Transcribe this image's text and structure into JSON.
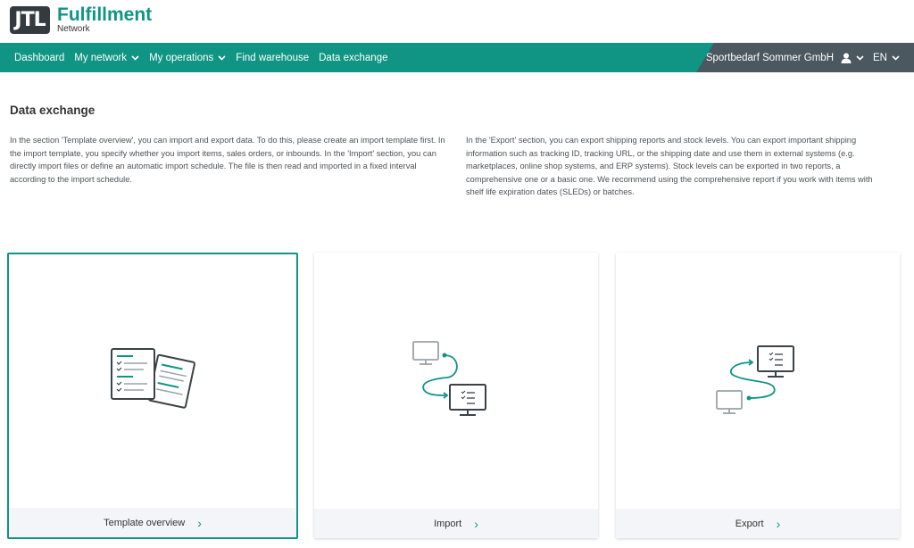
{
  "brand": {
    "logo_abbr": "JTL",
    "title": "Fulfillment",
    "subtitle": "Network",
    "accent": "#109584",
    "dark": "#4b5860"
  },
  "nav": {
    "items": [
      {
        "label": "Dashboard"
      },
      {
        "label": "My network"
      },
      {
        "label": "My operations"
      },
      {
        "label": "Find warehouse"
      },
      {
        "label": "Data exchange"
      }
    ],
    "company": "Sportbedarf Sommer GmbH",
    "language": "EN"
  },
  "page": {
    "title": "Data exchange",
    "desc_left": "In the section 'Template overview', you can import and export data. To do this, please create an import template first. In the import template, you specify whether you import items, sales orders, or inbounds. In the 'Import' section, you can directly import files or define an automatic import schedule. The file is then read and imported in a fixed interval according to the import schedule.",
    "desc_right": "In the 'Export' section, you can export shipping reports and stock levels. You can export important shipping information such as tracking ID, tracking URL, or the shipping date and use them in external systems (e.g. marketplaces, online shop systems, and ERP systems). Stock levels can be exported in two reports, a comprehensive one or a basic one. We recommend using the comprehensive report if you work with items with shelf life expiration dates (SLEDs) or batches."
  },
  "cards": [
    {
      "label": "Template overview",
      "icon": "documents-icon"
    },
    {
      "label": "Import",
      "icon": "import-icon"
    },
    {
      "label": "Export",
      "icon": "export-icon"
    }
  ]
}
